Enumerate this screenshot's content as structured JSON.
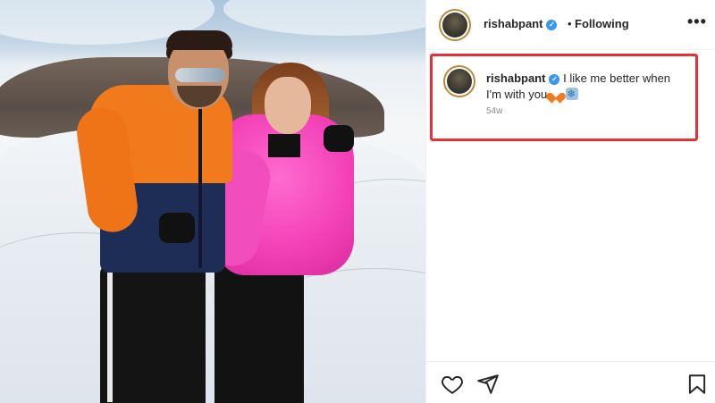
{
  "post": {
    "username": "rishabpant",
    "separator": "•",
    "follow_status": "Following",
    "more_label": "•••",
    "caption_username": "rishabpant",
    "caption_text": "I like me better when I'm with you",
    "caption_time": "54w"
  },
  "icons": {
    "verified": "verified-badge-icon",
    "heart": "heart-icon",
    "share": "share-icon",
    "save": "bookmark-icon",
    "more": "more-options-icon"
  },
  "colors": {
    "verified_blue": "#3897f0",
    "highlight_red": "#e8303a",
    "avatar_ring": "#b88a3a"
  }
}
